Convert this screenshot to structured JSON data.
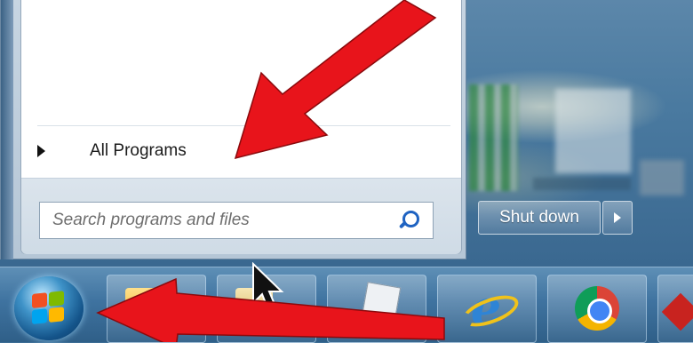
{
  "start_menu": {
    "all_programs_label": "All Programs",
    "search_placeholder": "Search programs and files"
  },
  "shutdown": {
    "label": "Shut down"
  },
  "taskbar": {
    "items": [
      "folder",
      "windows-explorer",
      "notepad",
      "internet-explorer",
      "chrome",
      "pinned-app"
    ],
    "ie_glyph": "e"
  },
  "annotations": {
    "arrow_color": "#e8141b"
  }
}
